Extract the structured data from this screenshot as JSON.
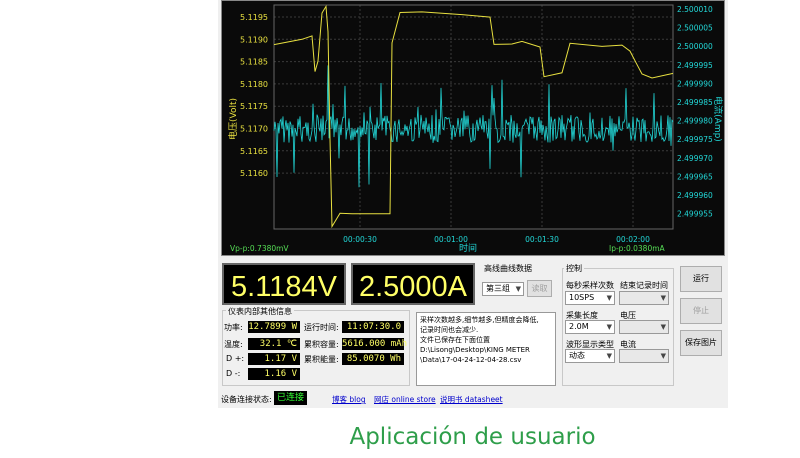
{
  "chart": {
    "left_axis_label": "电压(Volt)",
    "right_axis_label": "电流(Amp)",
    "x_axis_label": "时间",
    "left_ticks": [
      "5.1195",
      "5.1190",
      "5.1185",
      "5.1180",
      "5.1175",
      "5.1170",
      "5.1165",
      "5.1160"
    ],
    "right_ticks": [
      "2.500010",
      "2.500005",
      "2.500000",
      "2.499995",
      "2.499990",
      "2.499985",
      "2.499980",
      "2.499975",
      "2.499970",
      "2.499965",
      "2.499960",
      "2.499955"
    ],
    "time_ticks": [
      "00:00:30",
      "00:01:00",
      "00:01:30",
      "00:02:00"
    ],
    "vpp": "Vp-p:0.7380mV",
    "ipp": "Ip-p:0.0380mA",
    "voltage_color": "#e8e040",
    "current_color": "#22d8d8"
  },
  "readouts": {
    "voltage": "5.1184V",
    "current": "2.5000A"
  },
  "info": {
    "title": "仪表内部其他信息",
    "rows": [
      {
        "label": "功率:",
        "value": "12.7899 W"
      },
      {
        "label": "温度:",
        "value": "32.1 ℃"
      },
      {
        "label": "D +:",
        "value": "1.17 V"
      },
      {
        "label": "D -:",
        "value": "1.16 V"
      }
    ],
    "right_rows": [
      {
        "label": "运行时间:",
        "value": "11:07:30.0"
      },
      {
        "label": "累积容量:",
        "value": "5616.000 mAh"
      },
      {
        "label": "累积能量:",
        "value": "85.0070 Wh"
      }
    ]
  },
  "curves": {
    "title": "高线曲线数据",
    "group_value": "第三组",
    "read_button": "读取",
    "notes": [
      "采样次数越多,细节越多,但精度会降低,",
      "记录时间也会减少.",
      "文件已保存在下面位置",
      "D:\\Lisong\\Desktop\\KING METER",
      "\\Data\\17-04-24-12-04-28.csv"
    ]
  },
  "control": {
    "title": "控制",
    "sample_rate_label": "每秒采样次数",
    "sample_rate_value": "10SPS",
    "end_time_label": "结束记录时间",
    "sample_len_label": "采集长度",
    "sample_len_value": "2.0M",
    "voltage_label": "电压",
    "wave_type_label": "波形显示类型",
    "wave_type_value": "动态",
    "current_label": "电流"
  },
  "buttons": {
    "run": "运行",
    "stop": "停止",
    "save_image": "保存图片"
  },
  "status": {
    "conn_label": "设备连接状态:",
    "conn_value": "已连接",
    "links": [
      "博客 blog",
      "网店 online store",
      "说明书 datasheet"
    ]
  },
  "caption": "Aplicación de usuario"
}
